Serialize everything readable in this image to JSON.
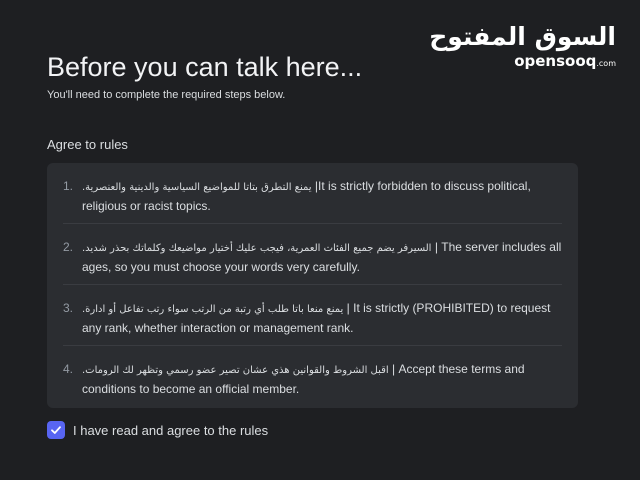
{
  "brand": {
    "arabic_name": "السوق المفتوح",
    "latin_name": "opensooq",
    "latin_suffix": ".com"
  },
  "header": {
    "title": "Before you can talk here...",
    "subtitle": "You'll need to complete the required steps below."
  },
  "rules_section": {
    "label": "Agree to rules",
    "rules": [
      {
        "number": "1.",
        "arabic": "يمنع التطرق بتاتا للمواضيع السياسية والدينية والعنصرية.",
        "english": "|It is strictly forbidden to discuss political, religious or racist topics."
      },
      {
        "number": "2.",
        "arabic": "السيرفر يضم جميع الفئات العمرية، فيجب عليك أختيار مواضيعك وكلماتك بحذر شديد.",
        "english": "| The server includes all ages, so you must choose your words very carefully."
      },
      {
        "number": "3.",
        "arabic": "يمنع منعا باتا طلب أي رتبة من الرتب سواء رتب تفاعل أو ادارة.",
        "english": "| It is strictly (PROHIBITED) to request any rank, whether interaction or management rank."
      },
      {
        "number": "4.",
        "arabic": "اقبل الشروط والقوانين هذي عشان تصير عضو رسمي وتظهر لك الرومات.",
        "english": "| Accept these terms and conditions to become an official member."
      }
    ]
  },
  "agreement": {
    "checked": true,
    "label": "I have read and agree to the rules",
    "checkbox_color": "#5865f2"
  }
}
